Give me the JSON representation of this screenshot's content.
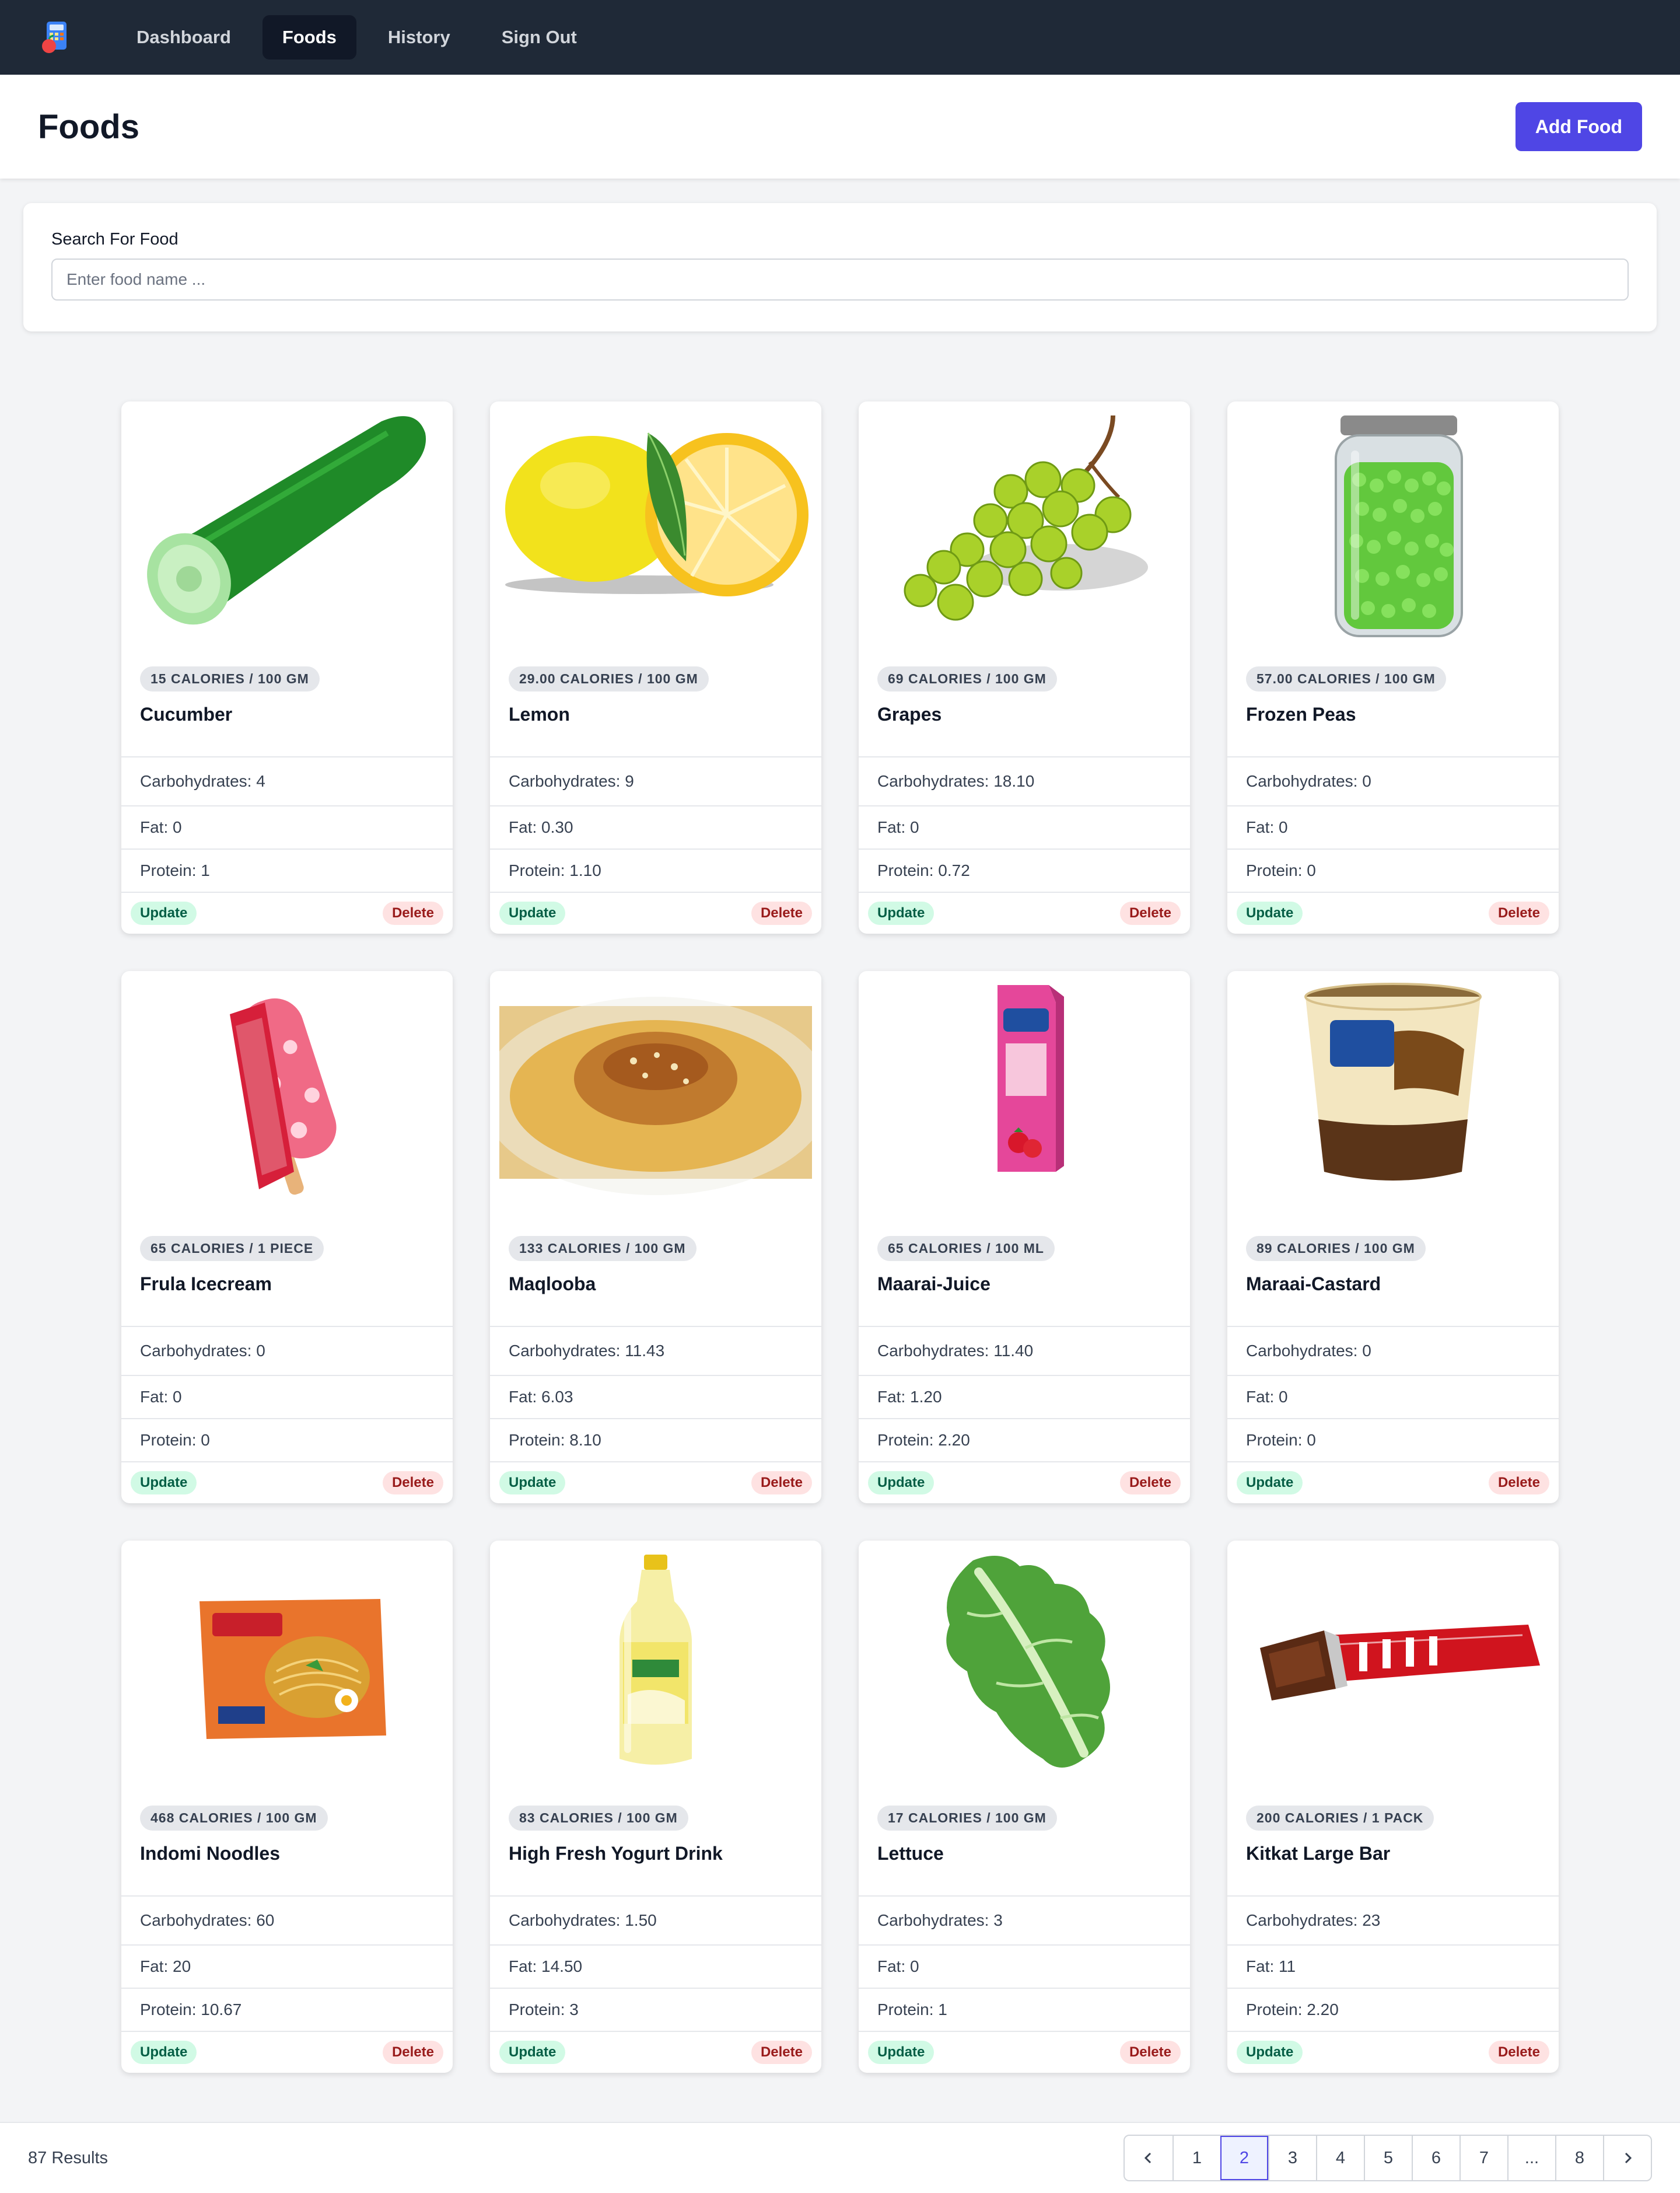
{
  "nav": {
    "items": [
      {
        "label": "Dashboard",
        "active": false
      },
      {
        "label": "Foods",
        "active": true
      },
      {
        "label": "History",
        "active": false
      },
      {
        "label": "Sign Out",
        "active": false
      }
    ]
  },
  "header": {
    "title": "Foods",
    "add_button": "Add Food"
  },
  "search": {
    "label": "Search For Food",
    "placeholder": "Enter food name ..."
  },
  "card_actions": {
    "update": "Update",
    "delete": "Delete"
  },
  "foods": [
    {
      "name": "Cucumber",
      "calories": "15 CALORIES / 100 GM",
      "carbs": "Carbohydrates: 4",
      "fat": "Fat: 0",
      "protein": "Protein: 1",
      "image": "cucumber"
    },
    {
      "name": "Lemon",
      "calories": "29.00 CALORIES / 100 GM",
      "carbs": "Carbohydrates: 9",
      "fat": "Fat: 0.30",
      "protein": "Protein: 1.10",
      "image": "lemon"
    },
    {
      "name": "Grapes",
      "calories": "69 CALORIES / 100 GM",
      "carbs": "Carbohydrates: 18.10",
      "fat": "Fat: 0",
      "protein": "Protein: 0.72",
      "image": "grapes"
    },
    {
      "name": "Frozen Peas",
      "calories": "57.00 CALORIES / 100 GM",
      "carbs": "Carbohydrates: 0",
      "fat": "Fat: 0",
      "protein": "Protein: 0",
      "image": "peas-jar"
    },
    {
      "name": "Frula Icecream",
      "calories": "65 CALORIES / 1 PIECE",
      "carbs": "Carbohydrates: 0",
      "fat": "Fat: 0",
      "protein": "Protein: 0",
      "image": "popsicle"
    },
    {
      "name": "Maqlooba",
      "calories": "133 CALORIES / 100 GM",
      "carbs": "Carbohydrates: 11.43",
      "fat": "Fat: 6.03",
      "protein": "Protein: 8.10",
      "image": "rice-dish"
    },
    {
      "name": "Maarai-Juice",
      "calories": "65 CALORIES / 100 ML",
      "carbs": "Carbohydrates: 11.40",
      "fat": "Fat: 1.20",
      "protein": "Protein: 2.20",
      "image": "juice-carton"
    },
    {
      "name": "Maraai-Castard",
      "calories": "89 CALORIES / 100 GM",
      "carbs": "Carbohydrates: 0",
      "fat": "Fat: 0",
      "protein": "Protein: 0",
      "image": "custard-cup"
    },
    {
      "name": "Indomi Noodles",
      "calories": "468 CALORIES / 100 GM",
      "carbs": "Carbohydrates: 60",
      "fat": "Fat: 20",
      "protein": "Protein: 10.67",
      "image": "noodle-pack"
    },
    {
      "name": "High Fresh Yogurt Drink",
      "calories": "83 CALORIES / 100 GM",
      "carbs": "Carbohydrates: 1.50",
      "fat": "Fat: 14.50",
      "protein": "Protein: 3",
      "image": "yogurt-bottle"
    },
    {
      "name": "Lettuce",
      "calories": "17 CALORIES / 100 GM",
      "carbs": "Carbohydrates: 3",
      "fat": "Fat: 0",
      "protein": "Protein: 1",
      "image": "lettuce"
    },
    {
      "name": "Kitkat Large Bar",
      "calories": "200 CALORIES / 1 PACK",
      "carbs": "Carbohydrates: 23",
      "fat": "Fat: 11",
      "protein": "Protein: 2.20",
      "image": "chocolate-bar"
    }
  ],
  "footer": {
    "results": "87 Results",
    "pages": [
      "1",
      "2",
      "3",
      "4",
      "5",
      "6",
      "7",
      "...",
      "8"
    ],
    "current_page": "2"
  },
  "colors": {
    "nav_bg": "#1f2937",
    "accent": "#4f46e5",
    "update_bg": "#d1fae5",
    "delete_bg": "#fee2e2"
  }
}
